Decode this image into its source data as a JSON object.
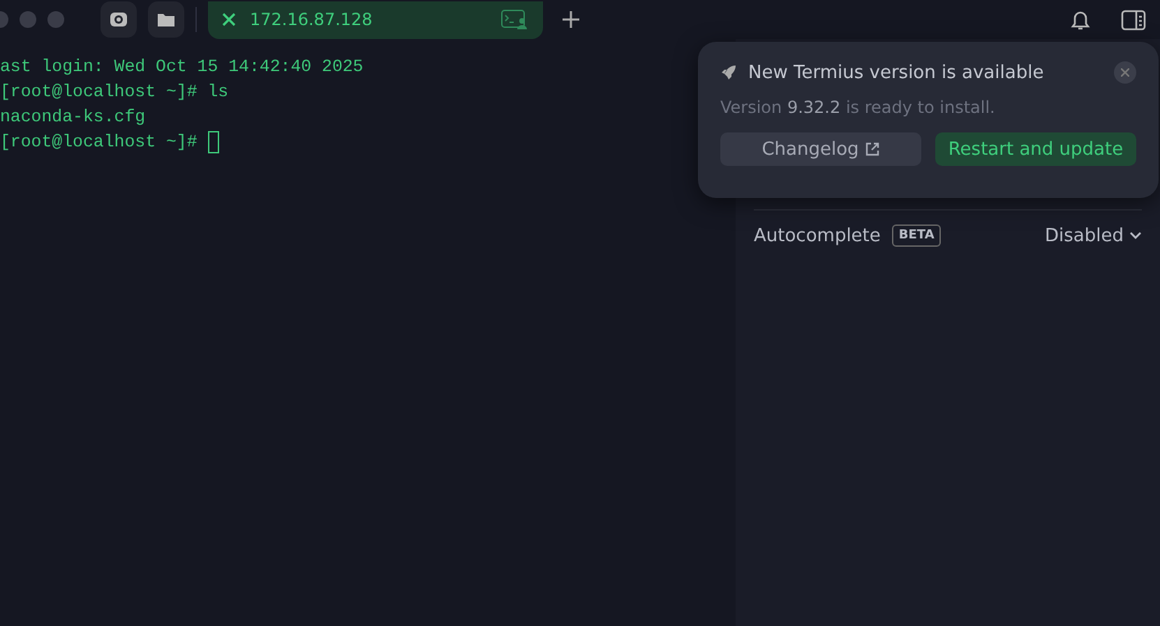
{
  "tabs": [
    {
      "label": "172.16.87.128",
      "selected": true
    }
  ],
  "terminal": {
    "lines": [
      "ast login: Wed Oct 15 14:42:40 2025",
      "[root@localhost ~]# ls",
      "naconda-ks.cfg",
      "[root@localhost ~]# "
    ]
  },
  "notification": {
    "title": "New Termius version is available",
    "message": "Version **9.32.2** is ready to install.",
    "buttons": [
      {
        "label": "Changelog",
        "kind": "external"
      },
      {
        "label": "Restart and update",
        "kind": "primary"
      }
    ]
  },
  "settings": [
    {
      "label": "Autocomplete",
      "badge": "BETA",
      "value": "Disabled"
    }
  ]
}
